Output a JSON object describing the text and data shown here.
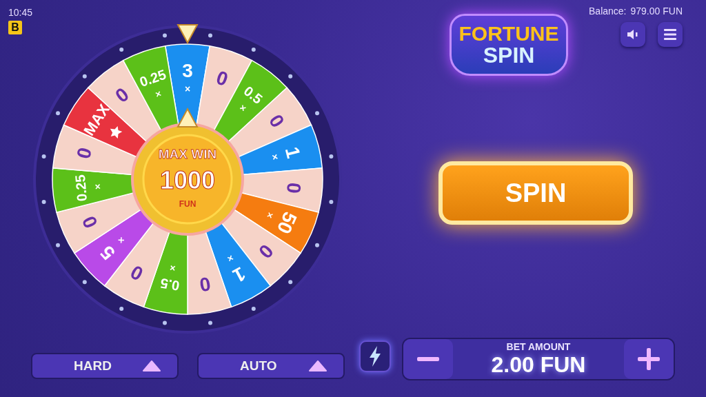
{
  "status": {
    "time": "10:45",
    "badge": "B"
  },
  "wheel": {
    "segments": [
      {
        "kind": "multiplier",
        "value": "3",
        "sign": "×",
        "color": "#1a8ff0"
      },
      {
        "kind": "zero",
        "value": "0",
        "color": "#f6d3c8"
      },
      {
        "kind": "multiplier",
        "value": "0.5",
        "sign": "×",
        "color": "#5cc019"
      },
      {
        "kind": "zero",
        "value": "0",
        "color": "#f6d3c8"
      },
      {
        "kind": "multiplier",
        "value": "1",
        "sign": "×",
        "color": "#1a8ff0"
      },
      {
        "kind": "zero",
        "value": "0",
        "color": "#f6d3c8"
      },
      {
        "kind": "multiplier",
        "value": "50",
        "sign": "×",
        "color": "#f57c10"
      },
      {
        "kind": "zero",
        "value": "0",
        "color": "#f6d3c8"
      },
      {
        "kind": "multiplier",
        "value": "1",
        "sign": "×",
        "color": "#1a8ff0"
      },
      {
        "kind": "zero",
        "value": "0",
        "color": "#f6d3c8"
      },
      {
        "kind": "multiplier",
        "value": "0.5",
        "sign": "×",
        "color": "#5cc019"
      },
      {
        "kind": "zero",
        "value": "0",
        "color": "#f6d3c8"
      },
      {
        "kind": "multiplier",
        "value": "5",
        "sign": "×",
        "color": "#b94ae8"
      },
      {
        "kind": "zero",
        "value": "0",
        "color": "#f6d3c8"
      },
      {
        "kind": "multiplier",
        "value": "0.25",
        "sign": "×",
        "color": "#5cc019"
      },
      {
        "kind": "zero",
        "value": "0",
        "color": "#f6d3c8"
      },
      {
        "kind": "max",
        "value": "MAX",
        "color": "#e8333f"
      },
      {
        "kind": "zero",
        "value": "0",
        "color": "#f6d3c8"
      },
      {
        "kind": "multiplier",
        "value": "0.25",
        "sign": "×",
        "color": "#5cc019"
      }
    ],
    "center": {
      "title": "MAX WIN",
      "amount": "1000",
      "currency": "FUN"
    }
  },
  "logo": {
    "line_1": "FORTUNE",
    "line_2": "SPIN"
  },
  "balance": {
    "label": "Balance:",
    "value": "979.00 FUN"
  },
  "spin_button": {
    "label": "SPIN"
  },
  "controls": {
    "mode": "HARD",
    "auto": "AUTO"
  },
  "bet": {
    "label": "BET AMOUNT",
    "value": "2.00 FUN"
  }
}
